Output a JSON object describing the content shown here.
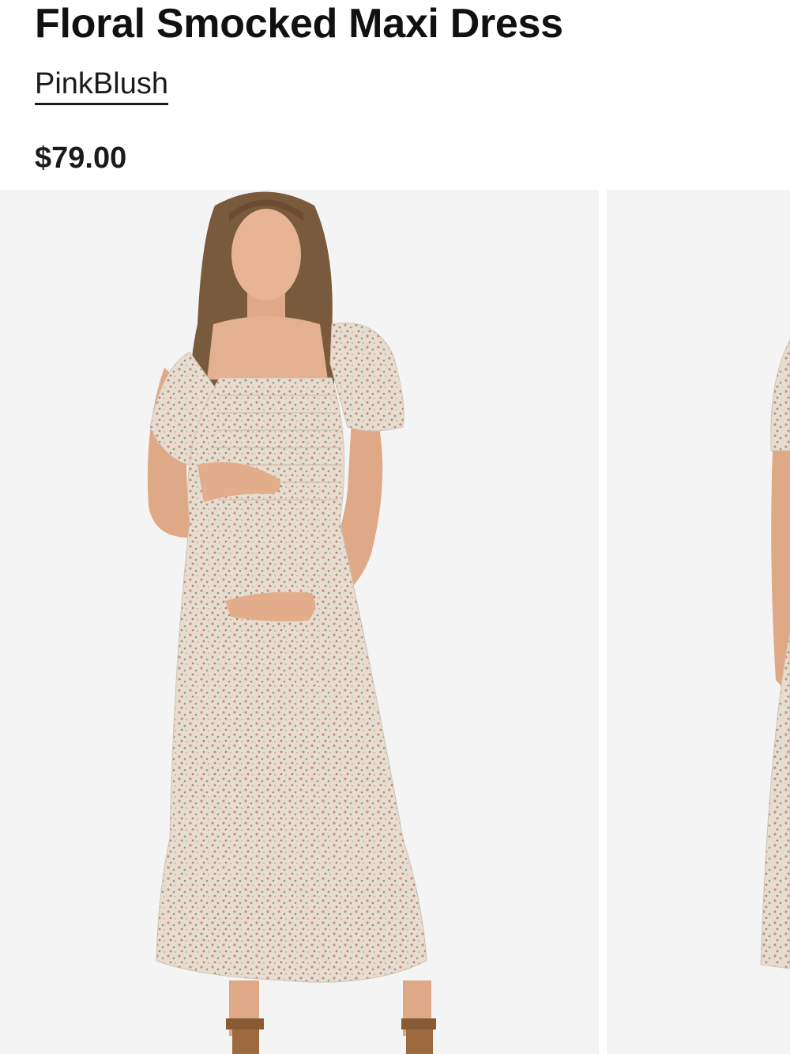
{
  "product": {
    "title": "Floral Smocked Maxi Dress",
    "brand": "PinkBlush",
    "price": "$79.00"
  },
  "gallery": {
    "images": [
      {
        "alt": "model-wearing-floral-smocked-maxi-dress-front"
      },
      {
        "alt": "model-wearing-floral-smocked-maxi-dress-side"
      }
    ]
  },
  "colors": {
    "text": "#111111",
    "image_background": "#f4f4f5",
    "dress": "#e3dacd",
    "skin": "#e3b191",
    "hair": "#7a5a3c"
  }
}
